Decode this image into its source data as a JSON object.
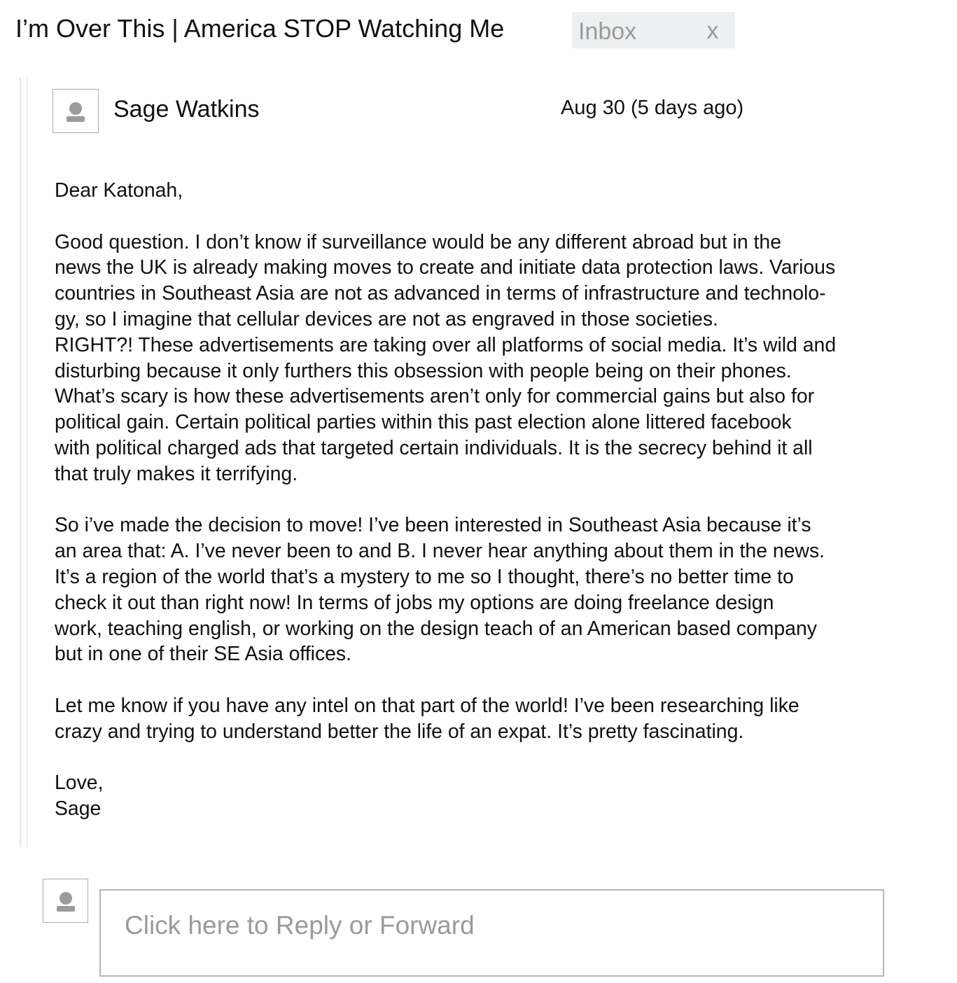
{
  "subject": "I’m Over This | America STOP Watching Me",
  "label_chip": {
    "text": "Inbox",
    "close": "x"
  },
  "message": {
    "sender": "Sage Watkins",
    "date": "Aug 30 (5 days ago)",
    "avatar_icon": "person-icon",
    "greeting": "Dear Katonah,",
    "paragraph_1": "Good question. I don’t know if surveillance would be any different abroad but in the\nnews the UK is already making moves to create and initiate data protection laws. Various\ncountries in Southeast Asia are not as advanced in terms of infrastructure and technolo-\ngy, so I imagine that cellular devices are not as engraved in those societies.\nRIGHT?! These advertisements are taking over all platforms of social media. It’s wild and\ndisturbing because it only furthers this obsession with people being on their phones.\nWhat’s scary is how these advertisements aren’t only for commercial gains but also for\npolitical gain. Certain political parties within this past election alone littered facebook\nwith political charged ads that targeted certain individuals. It is the secrecy behind it all\nthat truly makes it terrifying.",
    "paragraph_2": "So i’ve made the decision to move! I’ve been interested in Southeast Asia because it’s\nan area that:  A. I’ve never been to and B. I never hear anything about them in the news.\nIt’s a region of the world that’s a mystery to me so I thought, there’s no better time to\ncheck it out than right now! In terms of jobs my options are doing freelance design\nwork, teaching english, or working on the design teach of an American based company\nbut in one of their SE Asia offices.",
    "paragraph_3": "Let me know if you have any intel on that part of the world! I’ve been researching like\ncrazy and trying to understand better the life of an expat. It’s pretty fascinating.",
    "signoff": "Love,",
    "signature": "Sage"
  },
  "reply": {
    "placeholder": "Click here to Reply or Forward",
    "avatar_icon": "person-icon"
  },
  "colors": {
    "text": "#111111",
    "muted": "#9a9a9a",
    "chip_bg": "#eeeff0",
    "border": "#b5b5b5"
  }
}
